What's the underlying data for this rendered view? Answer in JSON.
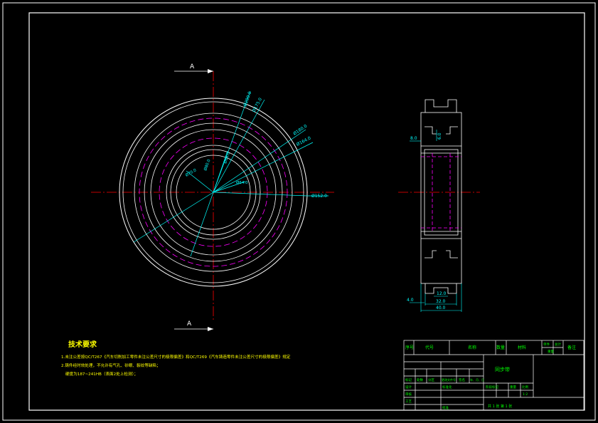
{
  "colors": {
    "background": "#000000",
    "outline": "#ffffff",
    "centerline": "#ff0000",
    "hidden": "#ff00ff",
    "dimension": "#00ffff",
    "text": "#ffff00",
    "title_text": "#00ff00"
  },
  "section_marks": {
    "top": "A",
    "bottom": "A"
  },
  "front_view_dims": {
    "d1": "Ø200.0",
    "d2": "Ø175.0",
    "d3": "Ø180.0",
    "d4": "Ø164.0",
    "d5": "Ø70.0",
    "d6": "Ø80.0",
    "d7": "Ø68.0",
    "d8": "Ø64.0",
    "d9": "Ø152.0"
  },
  "side_view_dims": {
    "left_small": "8.0",
    "inner": "6.0",
    "bottom_left": "4.0",
    "w_inner": "12.0",
    "w_mid": "32.0",
    "w_total": "40.0"
  },
  "tech_requirements": {
    "title": "技术要求",
    "lines": [
      "1.未注公差按QC/T267《汽车切削加工零件未注公差尺寸的极限偏差》和QC/T269《汽车铸造零件未注公差尺寸的极限偏差》规定",
      "2.铸件经时效处理，不允许有气孔、砂眼、裂纹等缺陷；",
      "硬度为187~241HB（表面2处上检测）；"
    ]
  },
  "title_block": {
    "header": [
      "序号",
      "代号",
      "名称",
      "数量",
      "材料",
      "单件",
      "总计",
      "备注"
    ],
    "header_sub": "重量",
    "part_name": "同步带",
    "rev_cells": [
      "标记",
      "处数",
      "分区",
      "更改文件号",
      "签名",
      "年、月、日"
    ],
    "roles": [
      "设计",
      "审核",
      "工艺",
      "标准化",
      "批准"
    ],
    "stage_cells": [
      "阶段标记",
      "重量",
      "比例"
    ],
    "scale": "1:2",
    "sheets": "共 1 张  第 1 张"
  }
}
